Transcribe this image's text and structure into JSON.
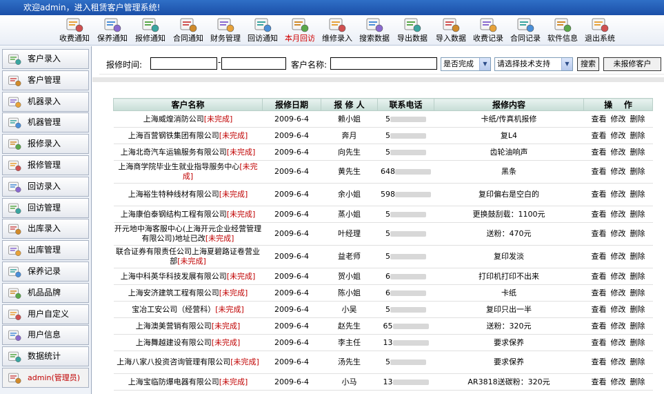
{
  "title": "欢迎admin，进入租赁客户管理系统!",
  "toolbar": [
    {
      "label": "收费通知",
      "icon": "fee-notice-icon",
      "active": false
    },
    {
      "label": "保养通知",
      "icon": "maintenance-notice-icon",
      "active": false
    },
    {
      "label": "报修通知",
      "icon": "repair-notice-icon",
      "active": false
    },
    {
      "label": "合同通知",
      "icon": "contract-notice-icon",
      "active": false
    },
    {
      "label": "财务管理",
      "icon": "finance-icon",
      "active": false
    },
    {
      "label": "回访通知",
      "icon": "revisit-notice-icon",
      "active": false
    },
    {
      "label": "本月回访",
      "icon": "monthly-revisit-icon",
      "active": true
    },
    {
      "label": "维修录入",
      "icon": "repair-entry-icon",
      "active": false
    },
    {
      "label": "搜索数据",
      "icon": "search-data-icon",
      "active": false
    },
    {
      "label": "导出数据",
      "icon": "export-data-icon",
      "active": false
    },
    {
      "label": "导入数据",
      "icon": "import-data-icon",
      "active": false
    },
    {
      "label": "收费记录",
      "icon": "fee-record-icon",
      "active": false
    },
    {
      "label": "合同记录",
      "icon": "contract-record-icon",
      "active": false
    },
    {
      "label": "软件信息",
      "icon": "home-icon",
      "active": false
    },
    {
      "label": "退出系统",
      "icon": "exit-icon",
      "active": false
    }
  ],
  "sidebar": [
    {
      "label": "客户录入",
      "icon": "customer-entry-icon"
    },
    {
      "label": "客户管理",
      "icon": "customer-manage-icon"
    },
    {
      "label": "机器录入",
      "icon": "machine-entry-icon"
    },
    {
      "label": "机器管理",
      "icon": "machine-manage-icon"
    },
    {
      "label": "报修录入",
      "icon": "repair-report-entry-icon"
    },
    {
      "label": "报修管理",
      "icon": "repair-report-manage-icon"
    },
    {
      "label": "回访录入",
      "icon": "revisit-entry-icon"
    },
    {
      "label": "回访管理",
      "icon": "revisit-manage-icon"
    },
    {
      "label": "出库录入",
      "icon": "outbound-entry-icon"
    },
    {
      "label": "出库管理",
      "icon": "outbound-manage-icon"
    },
    {
      "label": "保养记录",
      "icon": "maintenance-record-icon"
    },
    {
      "label": "机品品牌",
      "icon": "brand-icon"
    },
    {
      "label": "用户自定义",
      "icon": "user-custom-icon"
    },
    {
      "label": "用户信息",
      "icon": "user-info-icon"
    },
    {
      "label": "数据统计",
      "icon": "statistics-icon"
    },
    {
      "label": "admin(管理员)",
      "icon": "admin-icon"
    }
  ],
  "search": {
    "date_label": "报修时间:",
    "date_sep": "-",
    "customer_label": "客户名称:",
    "status_select": "是否完成",
    "tech_select": "请选择技术支持",
    "search_button": "搜索",
    "unrepaired_button": "未报修客户"
  },
  "table": {
    "headers": [
      "客户名称",
      "报修日期",
      "报 修 人",
      "联系电话",
      "报修内容",
      "操    作"
    ],
    "actions": [
      "查看",
      "修改",
      "删除"
    ],
    "rows": [
      {
        "name": "上海威煌消防公司",
        "status": "[未完成]",
        "date": "2009-6-4",
        "person": "赖小姐",
        "phone": "5",
        "content": "卡纸/传真机报修"
      },
      {
        "name": "上海百营钢铁集团有限公司",
        "status": "[未完成]",
        "date": "2009-6-4",
        "person": "奔月",
        "phone": "5",
        "content": "复L4"
      },
      {
        "name": "上海北奇汽车运输服务有限公司",
        "status": "[未完成]",
        "date": "2009-6-4",
        "person": "向先生",
        "phone": "5",
        "content": "齿轮油响声"
      },
      {
        "name": "上海商学院毕业生就业指导服务中心",
        "status": "[未完成]",
        "date": "2009-6-4",
        "person": "黄先生",
        "phone": "648",
        "content": "黑条"
      },
      {
        "name": "上海裕生特种线材有限公司",
        "status": "[未完成]",
        "date": "2009-6-4",
        "person": "余小姐",
        "phone": "598",
        "content": "复印偏右是空白的"
      },
      {
        "name": "上海康伯泰钢结构工程有限公司",
        "status": "[未完成]",
        "date": "2009-6-4",
        "person": "蒸小姐",
        "phone": "5",
        "content": "更换鼓刮载：1100元"
      },
      {
        "name": "开元地中海客服中心(上海开元企业经营管理有限公司)地址已改",
        "status": "[未完成]",
        "date": "2009-6-4",
        "person": "叶经理",
        "phone": "5",
        "content": "送粉：470元"
      },
      {
        "name": "联合证券有限责任公司上海夏碧路证卷营业部",
        "status": "[未完成]",
        "date": "2009-6-4",
        "person": "益老师",
        "phone": "5",
        "content": "复印发淡"
      },
      {
        "name": "上海中科英华科技发展有限公司",
        "status": "[未完成]",
        "date": "2009-6-4",
        "person": "贺小姐",
        "phone": "6",
        "content": "打印机打印不出来"
      },
      {
        "name": "上海安济建筑工程有限公司",
        "status": "[未完成]",
        "date": "2009-6-4",
        "person": "陈小姐",
        "phone": "6",
        "content": "卡纸"
      },
      {
        "name": "宝冶工安公司（经营科）",
        "status": "[未完成]",
        "date": "2009-6-4",
        "person": "小吴",
        "phone": "5",
        "content": "复印只出一半"
      },
      {
        "name": "上海澳美营销有限公司",
        "status": "[未完成]",
        "date": "2009-6-4",
        "person": "赵先生",
        "phone": "65",
        "content": "送粉：320元"
      },
      {
        "name": "上海舞越建设有限公司",
        "status": "[未完成]",
        "date": "2009-6-4",
        "person": "李主任",
        "phone": "13",
        "content": "要求保养"
      },
      {
        "name": "上海八家八投资咨询管理有限公司",
        "status": "[未完成]",
        "date": "2009-6-4",
        "person": "汤先生",
        "phone": "5",
        "content": "要求保养"
      },
      {
        "name": "上海宝临防爆电器有限公司",
        "status": "[未完成]",
        "date": "2009-6-4",
        "person": "小马",
        "phone": "13",
        "content": "AR3818送碳粉：320元"
      }
    ]
  },
  "colors": {
    "title_bar": "#1b4fa8",
    "status_red": "#c00000",
    "active_toolbar": "#d00000",
    "header_bg": "#c7ddd6"
  }
}
